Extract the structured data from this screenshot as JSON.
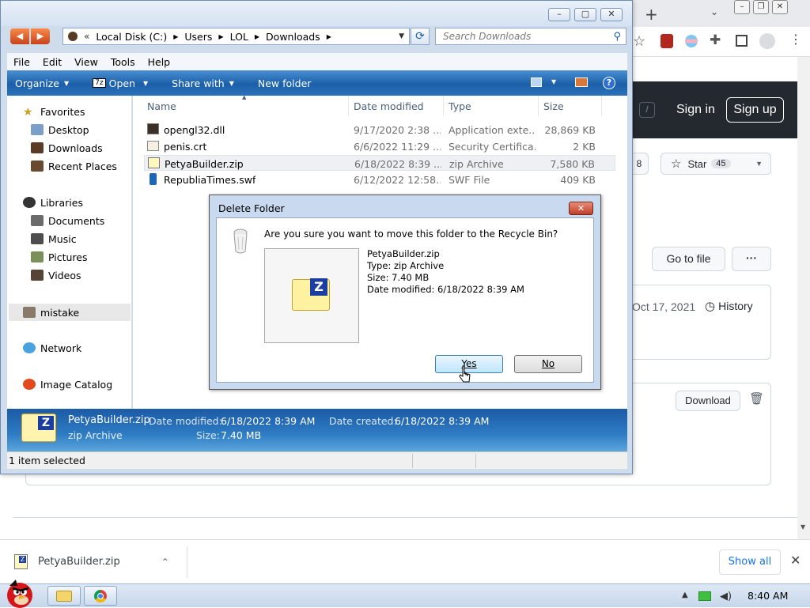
{
  "explorer": {
    "address": {
      "overflow": "«",
      "crumbs": [
        "Local Disk (C:)",
        "Users",
        "LOL",
        "Downloads"
      ]
    },
    "search_placeholder": "Search Downloads",
    "menu": [
      "File",
      "Edit",
      "View",
      "Tools",
      "Help"
    ],
    "commands": {
      "organize": "Organize",
      "open": "Open",
      "share_with": "Share with",
      "new_folder": "New folder"
    },
    "nav": {
      "favorites": "Favorites",
      "desktop": "Desktop",
      "downloads": "Downloads",
      "recent_places": "Recent Places",
      "libraries": "Libraries",
      "documents": "Documents",
      "music": "Music",
      "pictures": "Pictures",
      "videos": "Videos",
      "mistake": "mistake",
      "network": "Network",
      "image_catalog": "Image Catalog"
    },
    "columns": {
      "name": "Name",
      "date_modified": "Date modified",
      "type": "Type",
      "size": "Size"
    },
    "files": [
      {
        "name": "opengl32.dll",
        "date": "9/17/2020 2:38 ...",
        "type": "Application exte...",
        "size": "28,869 KB"
      },
      {
        "name": "penis.crt",
        "date": "6/6/2022 11:29 ...",
        "type": "Security Certifica...",
        "size": "2 KB"
      },
      {
        "name": "PetyaBuilder.zip",
        "date": "6/18/2022 8:39 ...",
        "type": "zip Archive",
        "size": "7,580 KB"
      },
      {
        "name": "RepubliaTimes.swf",
        "date": "6/12/2022 12:58...",
        "type": "SWF File",
        "size": "409 KB"
      }
    ],
    "details": {
      "name": "PetyaBuilder.zip",
      "type": "zip Archive",
      "date_modified_label": "Date modified:",
      "date_modified": "6/18/2022 8:39 AM",
      "date_created_label": "Date created:",
      "date_created": "6/18/2022 8:39 AM",
      "size_label": "Size:",
      "size": "7.40 MB"
    },
    "status": "1 item selected"
  },
  "dialog": {
    "title": "Delete Folder",
    "question": "Are you sure you want to move this folder to the Recycle Bin?",
    "file_name": "PetyaBuilder.zip",
    "file_type": "Type: zip Archive",
    "file_size": "Size: 7.40 MB",
    "file_date": "Date modified: 6/18/2022 8:39 AM",
    "yes": "Yes",
    "no": "No"
  },
  "github": {
    "slash": "/",
    "sign_in": "Sign in",
    "sign_up": "Sign up",
    "fork_count": "8",
    "star_label": "Star",
    "star_count": "45",
    "go_to_file": "Go to file",
    "more": "···",
    "date": "Oct 17, 2021",
    "history": "History",
    "download": "Download"
  },
  "download_bar": {
    "file": "PetyaBuilder.zip",
    "show_all": "Show all"
  },
  "taskbar": {
    "time": "8:40 AM"
  },
  "colors": {
    "accent_blue": "#1b5fa9",
    "github_header": "#24292f",
    "chrome_tab": "#e8eaed"
  }
}
